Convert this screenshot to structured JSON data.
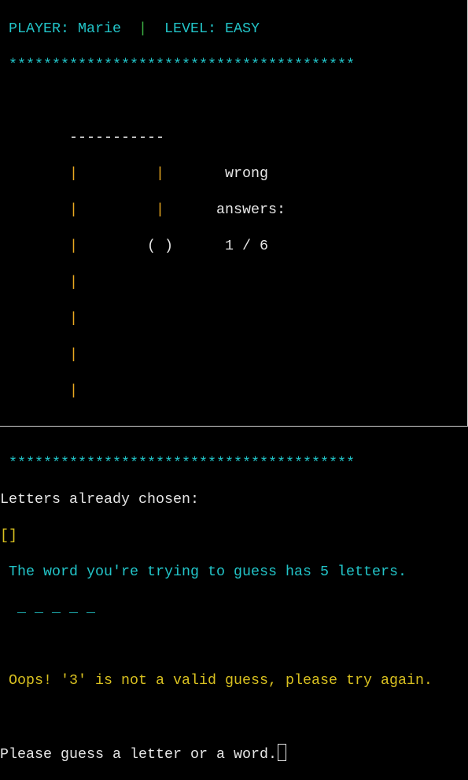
{
  "header": {
    "player_label": "PLAYER:",
    "player_name": "Marie",
    "separator": "|",
    "level_label": "LEVEL:",
    "level_value": "EASY"
  },
  "divider": "****************************************",
  "gallows": {
    "beam": "-----------",
    "pole": "|",
    "rope": "|",
    "head": "( )"
  },
  "wrong_answers": {
    "line1": "wrong",
    "line2": "answers:",
    "count": "1 / 6"
  },
  "letters_label": "Letters already chosen:",
  "letters_chosen": "[]",
  "word_info": "The word you're trying to guess has 5 letters.",
  "word_progress": "_ _ _ _ _",
  "error_message": "Oops! '3' is not a valid guess, please try again.",
  "prompt": "Please guess a letter or a word.",
  "colors": {
    "cyan": "#22c4c8",
    "yellow": "#d8c020",
    "pole": "#e8a820",
    "green": "#3cb043",
    "text": "#e6e6e6"
  }
}
